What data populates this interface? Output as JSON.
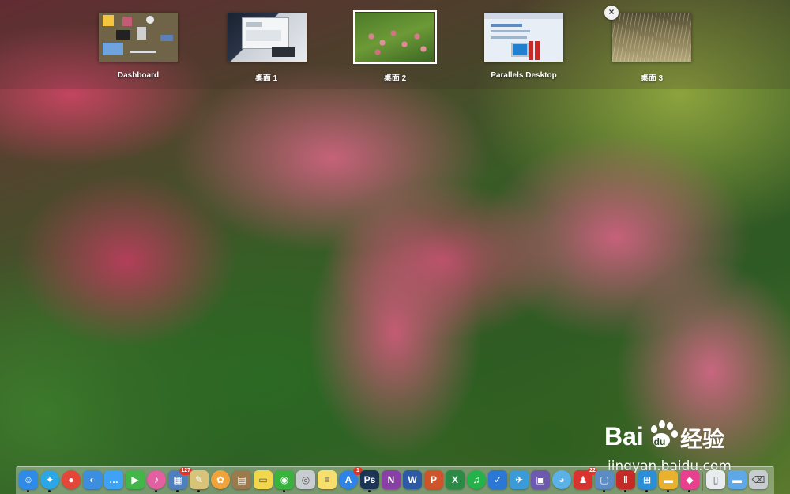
{
  "mission_control": {
    "spaces": [
      {
        "label": "Dashboard",
        "selected": false
      },
      {
        "label": "桌面 1",
        "selected": false
      },
      {
        "label": "桌面 2",
        "selected": true
      },
      {
        "label": "Parallels Desktop",
        "selected": false
      },
      {
        "label": "桌面 3",
        "selected": false,
        "close_label": "×"
      }
    ]
  },
  "dock": {
    "apps": [
      {
        "name": "finder-icon",
        "glyph": "☺",
        "color": "#2f8be8",
        "running": true
      },
      {
        "name": "safari-icon",
        "glyph": "✦",
        "color": "#2aa7e6",
        "running": true
      },
      {
        "name": "chrome-icon",
        "glyph": "●",
        "color": "#e4473a",
        "running": false
      },
      {
        "name": "qq-browser-icon",
        "glyph": "◐",
        "color": "#3c8fe0",
        "running": false
      },
      {
        "name": "messages-icon",
        "glyph": "…",
        "color": "#3ea2f5",
        "running": false
      },
      {
        "name": "facetime-icon",
        "glyph": "▶",
        "color": "#43b649",
        "running": false
      },
      {
        "name": "itunes-icon",
        "glyph": "♪",
        "color": "#e25fa1",
        "running": true
      },
      {
        "name": "preview-icon",
        "glyph": "▦",
        "color": "#4f7fbf",
        "badge": "127",
        "running": true
      },
      {
        "name": "text-edit-icon",
        "glyph": "✎",
        "color": "#d8c37a",
        "running": true
      },
      {
        "name": "photos-icon",
        "glyph": "✿",
        "color": "#f1a33b",
        "running": false
      },
      {
        "name": "notebook-icon",
        "glyph": "▤",
        "color": "#9b7a4d",
        "running": false
      },
      {
        "name": "stickies-icon",
        "glyph": "▭",
        "color": "#f2d64b",
        "running": false
      },
      {
        "name": "wechat-icon",
        "glyph": "◉",
        "color": "#39b33b",
        "running": true
      },
      {
        "name": "preview-doc-icon",
        "glyph": "◎",
        "color": "#c9cdd2",
        "running": false
      },
      {
        "name": "notes-icon",
        "glyph": "≡",
        "color": "#f6df6c",
        "running": false
      },
      {
        "name": "app-store-icon",
        "glyph": "A",
        "color": "#2d84e6",
        "badge": "1",
        "running": false
      },
      {
        "name": "photoshop-icon",
        "glyph": "Ps",
        "color": "#1c3556",
        "running": true
      },
      {
        "name": "onenote-icon",
        "glyph": "N",
        "color": "#8a3ea8",
        "running": false
      },
      {
        "name": "word-icon",
        "glyph": "W",
        "color": "#2c5aa7",
        "running": false
      },
      {
        "name": "powerpoint-icon",
        "glyph": "P",
        "color": "#d0542a",
        "running": false
      },
      {
        "name": "excel-icon",
        "glyph": "X",
        "color": "#2b8a46",
        "running": false
      },
      {
        "name": "qq-music-icon",
        "glyph": "♫",
        "color": "#24b24a",
        "running": false
      },
      {
        "name": "shield-icon",
        "glyph": "✓",
        "color": "#2b77d6",
        "running": false
      },
      {
        "name": "airmail-icon",
        "glyph": "✈",
        "color": "#3a9bd8",
        "running": false
      },
      {
        "name": "transmit-icon",
        "glyph": "▣",
        "color": "#6d5ab0",
        "running": false
      },
      {
        "name": "tweetbot-icon",
        "glyph": "◕",
        "color": "#5ab2e8",
        "running": false
      },
      {
        "name": "qq-icon",
        "glyph": "♟",
        "color": "#d8332e",
        "badge": "22",
        "running": false
      },
      {
        "name": "screen-sharing-icon",
        "glyph": "▢",
        "color": "#5b8cc4",
        "running": true
      },
      {
        "name": "parallels-icon",
        "glyph": "‖",
        "color": "#c52a27",
        "running": true
      },
      {
        "name": "windows-icon",
        "glyph": "⊞",
        "color": "#2a8fd8",
        "running": true
      },
      {
        "name": "folder-windows-icon",
        "glyph": "▬",
        "color": "#e8b22e",
        "running": true
      },
      {
        "name": "color-picker-icon",
        "glyph": "◆",
        "color": "#e83f8f",
        "running": true
      },
      {
        "name": "document-icon",
        "glyph": "▯",
        "color": "#e9ecef",
        "running": false
      },
      {
        "name": "folder-icon",
        "glyph": "▬",
        "color": "#5fa8e8",
        "running": false
      },
      {
        "name": "trash-icon",
        "glyph": "⌫",
        "color": "#c7ccd1",
        "running": false
      }
    ]
  }
}
